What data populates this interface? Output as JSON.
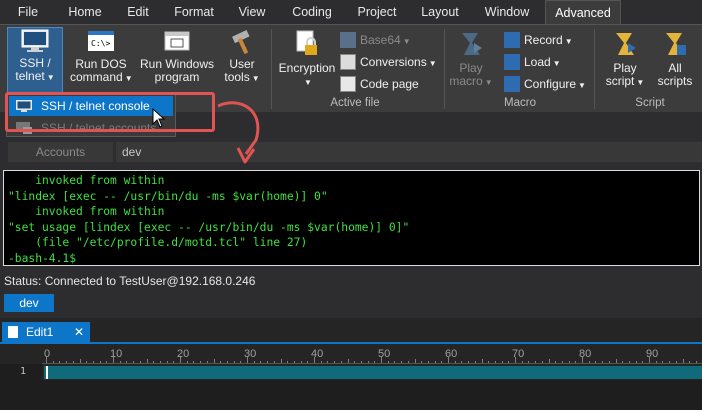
{
  "menu": {
    "tabs": [
      {
        "label": "File"
      },
      {
        "label": "Home"
      },
      {
        "label": "Edit"
      },
      {
        "label": "Format"
      },
      {
        "label": "View"
      },
      {
        "label": "Coding"
      },
      {
        "label": "Project"
      },
      {
        "label": "Layout"
      },
      {
        "label": "Window"
      },
      {
        "label": "Advanced"
      }
    ],
    "active": "Advanced"
  },
  "ribbon": {
    "ssh": {
      "line1": "SSH /",
      "line2": "telnet",
      "icon": "monitor-icon"
    },
    "dos": {
      "line1": "Run DOS",
      "line2": "command",
      "icon": "terminal-icon"
    },
    "win": {
      "line1": "Run Windows",
      "line2": "program",
      "icon": "window-icon"
    },
    "tools": {
      "line1": "User",
      "line2": "tools",
      "icon": "hammer-icon"
    },
    "encryption": {
      "label": "Encryption",
      "icon": "lock-icon"
    },
    "base64": {
      "label": "Base64",
      "icon": "base64-icon"
    },
    "conversions": {
      "label": "Conversions",
      "icon": "conversions-icon"
    },
    "codepage": {
      "label": "Code page",
      "icon": "codepage-icon"
    },
    "active_file_label": "Active file",
    "play_macro": {
      "line1": "Play",
      "line2": "macro",
      "icon": "play-macro-icon"
    },
    "record": {
      "label": "Record",
      "icon": "record-icon"
    },
    "load": {
      "label": "Load",
      "icon": "load-icon"
    },
    "configure": {
      "label": "Configure",
      "icon": "configure-icon"
    },
    "macro_label": "Macro",
    "play_script": {
      "line1": "Play",
      "line2": "script",
      "icon": "script-icon"
    },
    "all_scripts": {
      "line1": "All",
      "line2": "scripts",
      "icon": "scripts-icon"
    },
    "script_label": "Script"
  },
  "dropdown": {
    "items": [
      {
        "label": "SSH / telnet console",
        "icon": "console-icon"
      },
      {
        "label": "SSH / telnet accounts",
        "icon": "accounts-icon"
      }
    ]
  },
  "accounts": {
    "label": "Accounts",
    "value": "dev"
  },
  "terminal": {
    "lines": [
      "    invoked from within",
      "\"lindex [exec -- /usr/bin/du -ms $var(home)] 0\"",
      "    invoked from within",
      "\"set usage [lindex [exec -- /usr/bin/du -ms $var(home)] 0]\"",
      "    (file \"/etc/profile.d/motd.tcl\" line 27)",
      "-bash-4.1$"
    ]
  },
  "status": {
    "text": "Status: Connected to TestUser@192.168.0.246"
  },
  "session_tab": {
    "label": "dev"
  },
  "editor": {
    "tab_label": "Edit1",
    "close_glyph": "✕",
    "line_number": "1",
    "ruler_labels": [
      "0",
      "10",
      "20",
      "30",
      "40",
      "50",
      "60",
      "70",
      "80",
      "90"
    ]
  },
  "colors": {
    "accent": "#0e76c8",
    "callout": "#e05454",
    "terminal_text": "#3fe03f"
  }
}
